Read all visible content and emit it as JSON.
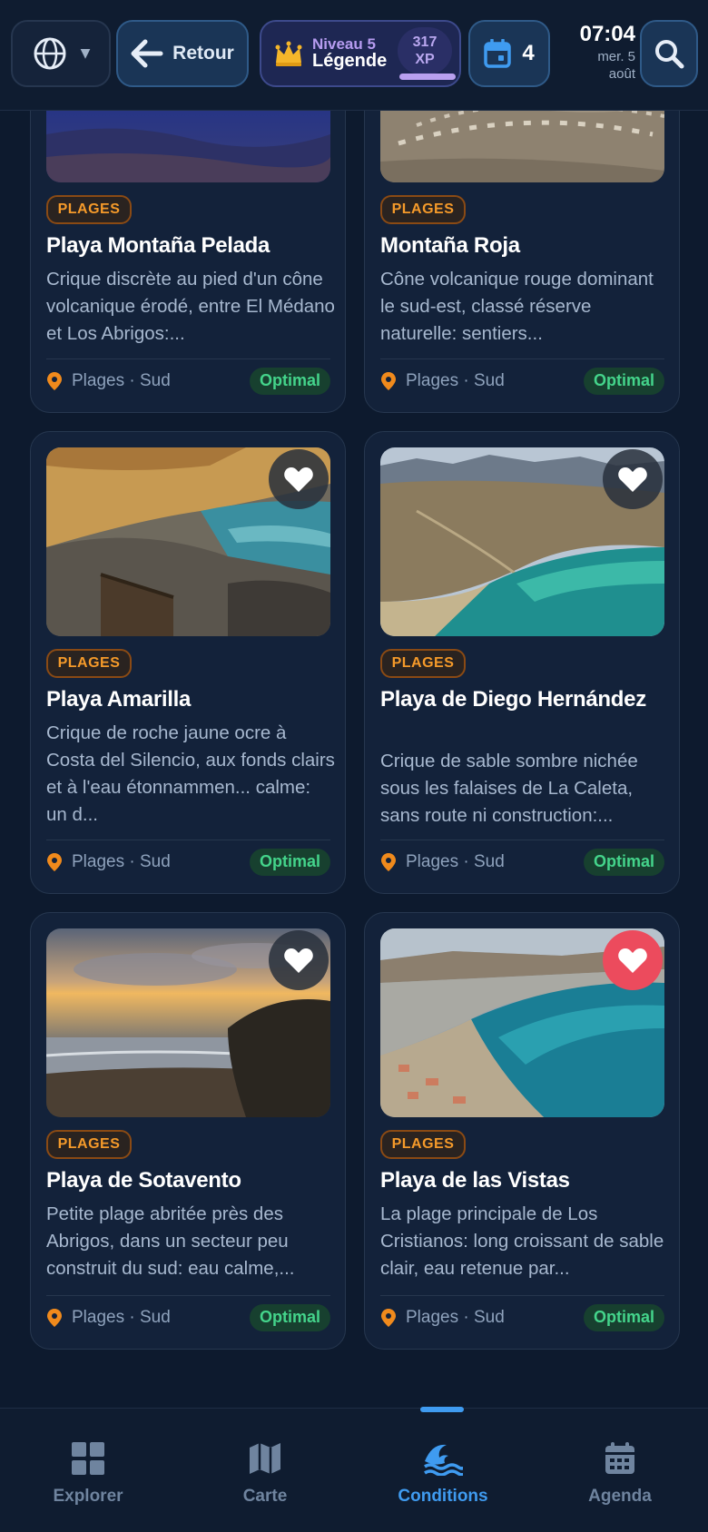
{
  "header": {
    "language_icon": "globe-icon",
    "back_label": "Retour",
    "level_label": "Niveau 5",
    "rank_label": "Légende",
    "xp_value": "317",
    "xp_unit": "XP",
    "xp_progress": 0.55,
    "calendar_count": "4",
    "time": "07:04",
    "date_line1": "mer. 5",
    "date_line2": "août"
  },
  "cards": [
    {
      "category": "PLAGES",
      "title": "Playa Montaña Pelada",
      "description": "Crique discrète au pied d'un cône volcanique érodé, entre El Médano et Los Abrigos:...",
      "location": "Plages · Sud",
      "status": "Optimal",
      "favorite": false
    },
    {
      "category": "PLAGES",
      "title": "Montaña Roja",
      "description": "Cône volcanique rouge dominant le sud-est, classé réserve naturelle: sentiers...",
      "location": "Plages · Sud",
      "status": "Optimal",
      "favorite": false
    },
    {
      "category": "PLAGES",
      "title": "Playa Amarilla",
      "description": "Crique de roche jaune ocre à Costa del Silencio, aux fonds clairs et à l'eau étonnammen... calme: un d...",
      "location": "Plages · Sud",
      "status": "Optimal",
      "favorite": false
    },
    {
      "category": "PLAGES",
      "title": "Playa de Diego Hernández",
      "description": "Crique de sable sombre nichée sous les falaises de La Caleta, sans route ni construction:...",
      "location": "Plages · Sud",
      "status": "Optimal",
      "favorite": false
    },
    {
      "category": "PLAGES",
      "title": "Playa de Sotavento",
      "description": "Petite plage abritée près des Abrigos, dans un secteur peu construit du sud: eau calme,...",
      "location": "Plages · Sud",
      "status": "Optimal",
      "favorite": false
    },
    {
      "category": "PLAGES",
      "title": "Playa de las Vistas",
      "description": "La plage principale de Los Cristianos: long croissant de sable clair, eau retenue par...",
      "location": "Plages · Sud",
      "status": "Optimal",
      "favorite": true
    }
  ],
  "nav": {
    "items": [
      {
        "label": "Explorer",
        "icon": "grid-icon"
      },
      {
        "label": "Carte",
        "icon": "map-icon"
      },
      {
        "label": "Conditions",
        "icon": "waves-icon"
      },
      {
        "label": "Agenda",
        "icon": "calendar-icon"
      }
    ],
    "active": "Conditions"
  },
  "colors": {
    "background": "#0d1a2e",
    "card": "#13223a",
    "accent": "#3f9bf0",
    "category": "#f59a2a",
    "optimal": "#44d48b",
    "favorite_active": "#ec4b5d"
  }
}
